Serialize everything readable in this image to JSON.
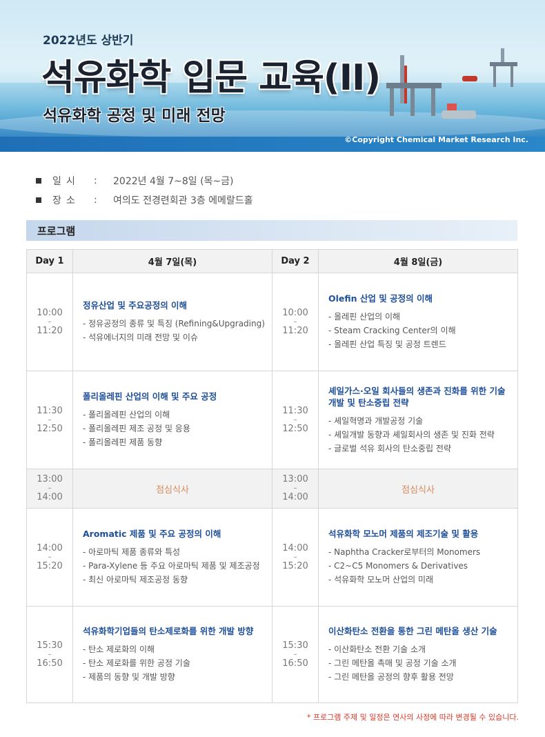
{
  "banner": {
    "year_label": "2022년도 상반기",
    "main_title": "석유화학 입문 교육(II)",
    "subtitle": "석유화학 공정 및 미래 전망",
    "copyright": "©Copyright Chemical Market Research Inc."
  },
  "info": {
    "date_key_1": "일",
    "date_key_2": "시",
    "date_value": "2022년 4월 7~8일 (목~금)",
    "place_key_1": "장",
    "place_key_2": "소",
    "place_value": "여의도 전경련회관 3층 에메랄드홀",
    "colon": ":"
  },
  "program_label": "프로그램",
  "table": {
    "day1_label": "Day 1",
    "day1_date": "4월 7일(목)",
    "day2_label": "Day 2",
    "day2_date": "4월 8일(금)",
    "rows": [
      {
        "start": "10:00",
        "end": "11:20",
        "d1_title": "정유산업 및 주요공정의 이해",
        "d1_items": [
          "- 정유공정의 종류 및 특징 (Refining&Upgrading)",
          "- 석유에너지의 미래 전망 및 이슈"
        ],
        "d2_title": "Olefin 산업 및 공정의 이해",
        "d2_items": [
          "- 올레핀 산업의 이해",
          "- Steam Cracking Center의 이해",
          "- 올레핀 산업 특징 및 공정 트렌드"
        ]
      },
      {
        "start": "11:30",
        "end": "12:50",
        "d1_title": "폴리올레핀 산업의 이해 및 주요 공정",
        "d1_items": [
          "- 폴리올레핀 산업의 이해",
          "- 폴리올레핀 제조 공정 및 응용",
          "- 폴리올레핀 제품 동향"
        ],
        "d2_title": "셰일가스·오일 회사들의 생존과 진화를 위한 기술개발 및 탄소중립 전략",
        "d2_items": [
          "- 셰일혁명과 개발공정 기술",
          "- 셰일개발 동향과 셰일회사의 생존 및 진화 전략",
          "- 글로벌 석유 회사의 탄소중립 전략"
        ]
      },
      {
        "start": "13:00",
        "end": "14:00",
        "lunch": "점심식사"
      },
      {
        "start": "14:00",
        "end": "15:20",
        "d1_title": "Aromatic 제품 및 주요 공정의 이해",
        "d1_items": [
          "- 아로마틱 제품 종류와 특성",
          "- Para-Xylene 등 주요 아로마틱 제품 및 제조공정",
          "- 최신 아로마틱 제조공정 동향"
        ],
        "d2_title": "석유화학 모노머 제품의 제조기술 및 활용",
        "d2_items": [
          "- Naphtha Cracker로부터의 Monomers",
          "- C2~C5 Monomers & Derivatives",
          "- 석유화학 모노머 산업의 미래"
        ]
      },
      {
        "start": "15:30",
        "end": "16:50",
        "d1_title": "석유화학기업들의 탄소제로화를 위한 개발 방향",
        "d1_items": [
          "- 탄소 제로화의 이해",
          "- 탄소 제로화를 위한 공정 기술",
          "- 제품의 동향 및 개발 방향"
        ],
        "d2_title": "이산화탄소 전환을 통한 그린 메탄올 생산 기술",
        "d2_items": [
          "- 이산화탄소 전환 기술 소개",
          "- 그린 메탄올 촉매 및 공정 기술 소개",
          "- 그린 메탄올 공정의 향후 활용 전망"
        ]
      }
    ]
  },
  "note": "* 프로그램 주제 및 일정은 연사의 사정에 따라 변경될 수 있습니다."
}
